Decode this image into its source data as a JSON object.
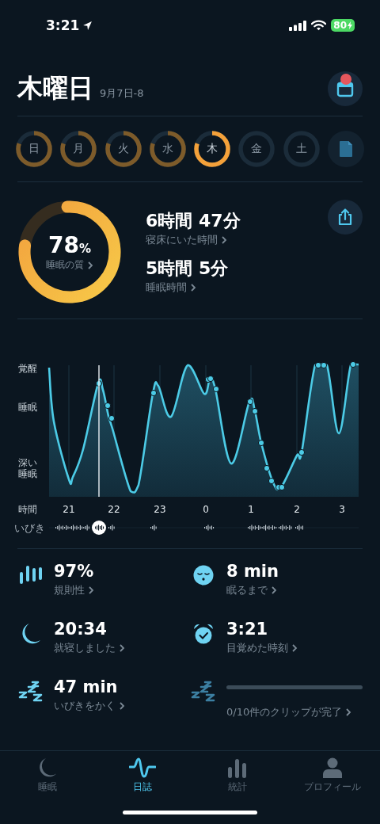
{
  "status_bar": {
    "time": "3:21",
    "battery": "80"
  },
  "header": {
    "title": "木曜日",
    "date": "9月7日-8",
    "calendar_badge": true
  },
  "days": [
    {
      "label": "日",
      "recorded": true,
      "selected": false
    },
    {
      "label": "月",
      "recorded": true,
      "selected": false
    },
    {
      "label": "火",
      "recorded": true,
      "selected": false
    },
    {
      "label": "水",
      "recorded": true,
      "selected": false
    },
    {
      "label": "木",
      "recorded": true,
      "selected": true
    },
    {
      "label": "金",
      "recorded": false,
      "selected": false
    },
    {
      "label": "土",
      "recorded": false,
      "selected": false
    }
  ],
  "quality": {
    "value": "78",
    "unit": "%",
    "label": "睡眠の質"
  },
  "durations": [
    {
      "value": "6時間 47分",
      "label": "寝床にいた時間"
    },
    {
      "value": "5時間 5分",
      "label": "睡眠時間"
    }
  ],
  "hypnogram": {
    "y_labels": [
      {
        "lines": [
          "覚醒"
        ]
      },
      {
        "lines": [
          "睡眠"
        ]
      },
      {
        "lines": [
          "深い",
          "睡眠"
        ]
      }
    ],
    "x_label": "時間",
    "x_ticks": [
      "21",
      "22",
      "23",
      "0",
      "1",
      "2",
      "3"
    ],
    "snore_label": "いびき"
  },
  "stats": [
    {
      "kind": "regularity",
      "value": "97%",
      "label": "規則性"
    },
    {
      "kind": "fall_asleep",
      "value": "8 min",
      "label": "眠るまで"
    },
    {
      "kind": "bedtime",
      "value": "20:34",
      "label": "就寝しました"
    },
    {
      "kind": "wake",
      "value": "3:21",
      "label": "目覚めた時刻"
    },
    {
      "kind": "snore",
      "value": "47 min",
      "label": "いびきをかく"
    },
    {
      "kind": "clips",
      "label": "0/10件のクリップが完了"
    }
  ],
  "nav": [
    {
      "kind": "sleep",
      "label": "睡眠",
      "selected": false
    },
    {
      "kind": "journal",
      "label": "日誌",
      "selected": true
    },
    {
      "kind": "stats",
      "label": "統計",
      "selected": false
    },
    {
      "kind": "profile",
      "label": "プロフィール",
      "selected": false
    }
  ]
}
